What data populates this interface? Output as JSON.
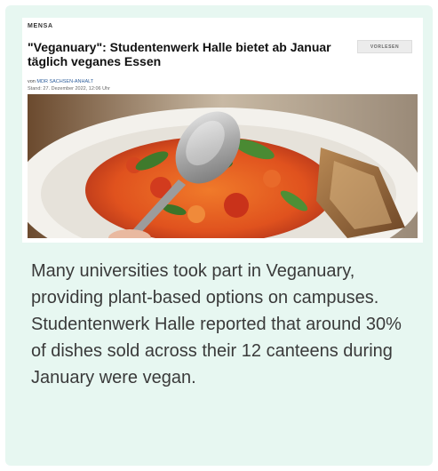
{
  "article": {
    "kicker": "MENSA",
    "headline": "\"Veganuary\": Studentenwerk Halle bietet ab Januar täglich veganes Essen",
    "read_aloud_label": "VORLESEN",
    "byline_prefix": "von",
    "author": "MDR SACHSEN-ANHALT",
    "date": "Stand: 27. Dezember 2022, 12:06 Uhr",
    "image_subject": "soup-with-spoon-and-bread-photo"
  },
  "caption": {
    "text": "Many universities took part in Veganuary, providing plant-based options on campuses. Studentenwerk Halle reported that around 30% of dishes sold across their 12 canteens during January were vegan."
  },
  "colors": {
    "card_background": "#e7f7f1",
    "link_blue": "#2f5f9c"
  }
}
